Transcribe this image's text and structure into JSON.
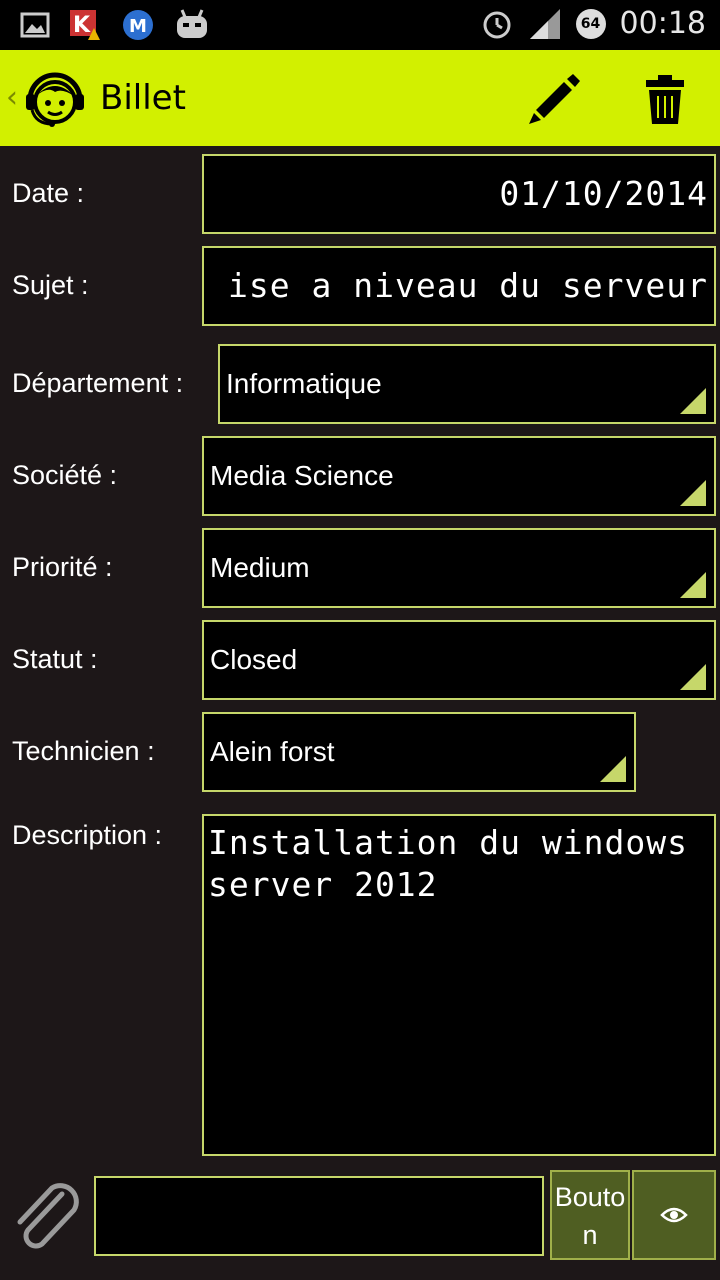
{
  "status_bar": {
    "time": "00:18",
    "badge": "64",
    "icons": [
      "image-icon",
      "kaspersky-icon",
      "mail-icon",
      "android-icon",
      "alarm-icon",
      "signal-icon"
    ]
  },
  "app_bar": {
    "title": "Billet",
    "back_glyph": "‹",
    "color": "#d2f000",
    "actions": [
      "pencil-icon",
      "trash-icon"
    ]
  },
  "form": {
    "date": {
      "label": "Date :",
      "value": "01/10/2014"
    },
    "subject": {
      "label": "Sujet :",
      "value": "ise a niveau du serveur"
    },
    "department": {
      "label": "Département :",
      "value": "Informatique"
    },
    "company": {
      "label": "Société :",
      "value": "Media Science"
    },
    "priority": {
      "label": "Priorité :",
      "value": "Medium"
    },
    "status": {
      "label": "Statut :",
      "value": "Closed"
    },
    "technician": {
      "label": "Technicien :",
      "value": "Alein forst"
    },
    "description": {
      "label": "Description :",
      "value": "Installation du windows server 2012"
    }
  },
  "bottom_bar": {
    "attach_icon": "paperclip-icon",
    "message_value": "",
    "button_label": "Bouton",
    "eye_icon": "eye-icon"
  },
  "colors": {
    "border": "#c6d76a",
    "button_bg": "#4f5e22",
    "background": "#1d1718"
  }
}
